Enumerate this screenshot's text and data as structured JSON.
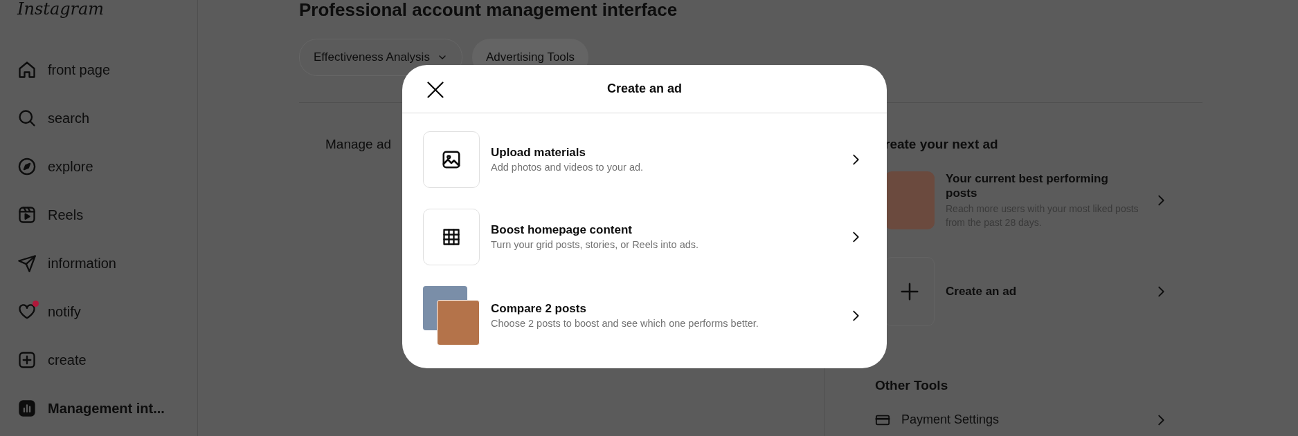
{
  "logo": "Instagram",
  "sidebar": {
    "items": [
      {
        "label": "front page",
        "selected": false,
        "has_notification": false
      },
      {
        "label": "search",
        "selected": false,
        "has_notification": false
      },
      {
        "label": "explore",
        "selected": false,
        "has_notification": false
      },
      {
        "label": "Reels",
        "selected": false,
        "has_notification": false
      },
      {
        "label": "information",
        "selected": false,
        "has_notification": false
      },
      {
        "label": "notify",
        "selected": false,
        "has_notification": true
      },
      {
        "label": "create",
        "selected": false,
        "has_notification": false
      },
      {
        "label": "Management int...",
        "selected": true,
        "has_notification": false
      }
    ]
  },
  "page": {
    "title": "Professional account management interface",
    "tabs": [
      {
        "label": "Effectiveness Analysis",
        "dropdown": true,
        "selected": false
      },
      {
        "label": "Advertising Tools",
        "dropdown": false,
        "selected": true
      }
    ],
    "manage_ads": {
      "heading": "Manage ad"
    },
    "next_ad": {
      "heading": "reate your next ad",
      "items": [
        {
          "kind": "post",
          "title": "Your current best performing posts",
          "description": "Reach more users with your most liked posts from the past 28 days."
        },
        {
          "kind": "create",
          "title": "Create an ad"
        }
      ]
    },
    "other_tools": {
      "heading": "Other Tools",
      "items": [
        {
          "label": "Payment Settings"
        }
      ]
    }
  },
  "modal": {
    "title": "Create an ad",
    "options": [
      {
        "kind": "image",
        "title": "Upload materials",
        "description": "Add photos and videos to your ad."
      },
      {
        "kind": "grid",
        "title": "Boost homepage content",
        "description": "Turn your grid posts, stories, or Reels into ads."
      },
      {
        "kind": "photos",
        "title": "Compare 2 posts",
        "description": "Choose 2 posts to boost and see which one performs better."
      }
    ]
  }
}
